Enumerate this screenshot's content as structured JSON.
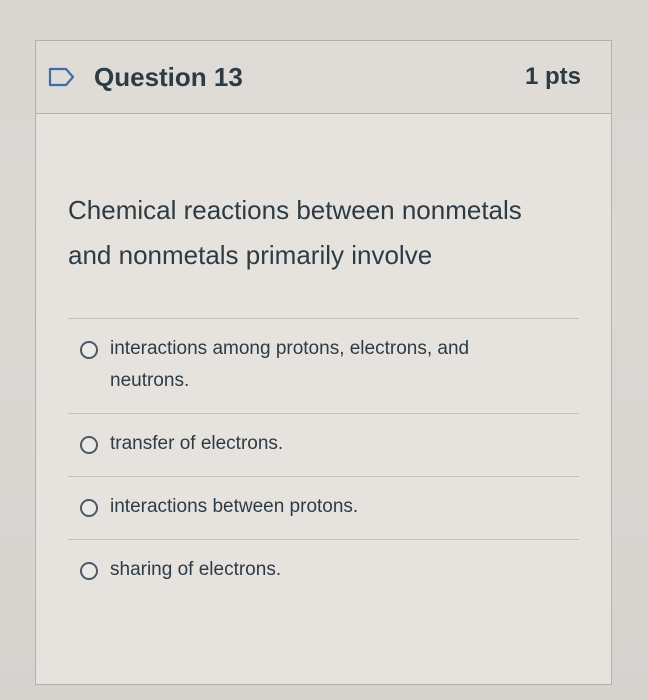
{
  "question": {
    "title": "Question 13",
    "points": "1 pts",
    "text": "Chemical reactions between nonmetals and nonmetals primarily involve",
    "flag_icon": "flag-outline-icon"
  },
  "answers": [
    {
      "label": "interactions among protons, electrons, and neutrons."
    },
    {
      "label": "transfer of electrons."
    },
    {
      "label": "interactions between protons."
    },
    {
      "label": "sharing of electrons."
    }
  ],
  "colors": {
    "text": "#2d3b45",
    "border": "#b3b0ab",
    "header_bg": "#dfdcd7",
    "card_bg": "#e6e3df"
  }
}
